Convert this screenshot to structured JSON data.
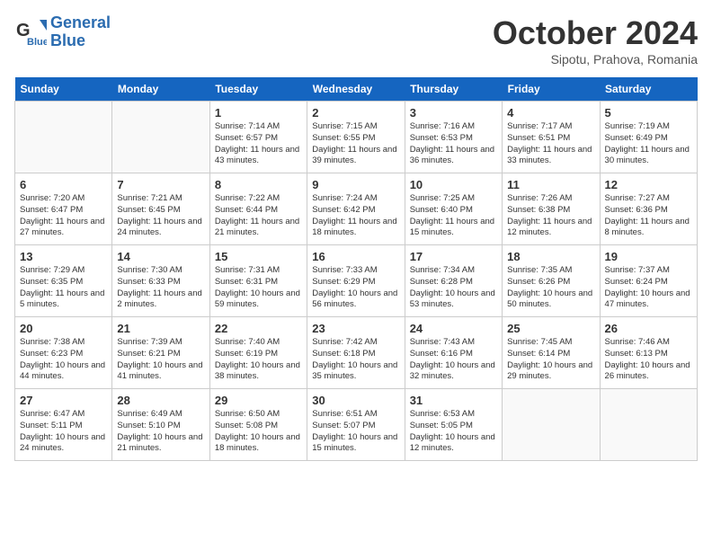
{
  "header": {
    "logo_line1": "General",
    "logo_line2": "Blue",
    "month": "October 2024",
    "location": "Sipotu, Prahova, Romania"
  },
  "days_of_week": [
    "Sunday",
    "Monday",
    "Tuesday",
    "Wednesday",
    "Thursday",
    "Friday",
    "Saturday"
  ],
  "weeks": [
    [
      {
        "day": "",
        "info": ""
      },
      {
        "day": "",
        "info": ""
      },
      {
        "day": "1",
        "info": "Sunrise: 7:14 AM\nSunset: 6:57 PM\nDaylight: 11 hours and 43 minutes."
      },
      {
        "day": "2",
        "info": "Sunrise: 7:15 AM\nSunset: 6:55 PM\nDaylight: 11 hours and 39 minutes."
      },
      {
        "day": "3",
        "info": "Sunrise: 7:16 AM\nSunset: 6:53 PM\nDaylight: 11 hours and 36 minutes."
      },
      {
        "day": "4",
        "info": "Sunrise: 7:17 AM\nSunset: 6:51 PM\nDaylight: 11 hours and 33 minutes."
      },
      {
        "day": "5",
        "info": "Sunrise: 7:19 AM\nSunset: 6:49 PM\nDaylight: 11 hours and 30 minutes."
      }
    ],
    [
      {
        "day": "6",
        "info": "Sunrise: 7:20 AM\nSunset: 6:47 PM\nDaylight: 11 hours and 27 minutes."
      },
      {
        "day": "7",
        "info": "Sunrise: 7:21 AM\nSunset: 6:45 PM\nDaylight: 11 hours and 24 minutes."
      },
      {
        "day": "8",
        "info": "Sunrise: 7:22 AM\nSunset: 6:44 PM\nDaylight: 11 hours and 21 minutes."
      },
      {
        "day": "9",
        "info": "Sunrise: 7:24 AM\nSunset: 6:42 PM\nDaylight: 11 hours and 18 minutes."
      },
      {
        "day": "10",
        "info": "Sunrise: 7:25 AM\nSunset: 6:40 PM\nDaylight: 11 hours and 15 minutes."
      },
      {
        "day": "11",
        "info": "Sunrise: 7:26 AM\nSunset: 6:38 PM\nDaylight: 11 hours and 12 minutes."
      },
      {
        "day": "12",
        "info": "Sunrise: 7:27 AM\nSunset: 6:36 PM\nDaylight: 11 hours and 8 minutes."
      }
    ],
    [
      {
        "day": "13",
        "info": "Sunrise: 7:29 AM\nSunset: 6:35 PM\nDaylight: 11 hours and 5 minutes."
      },
      {
        "day": "14",
        "info": "Sunrise: 7:30 AM\nSunset: 6:33 PM\nDaylight: 11 hours and 2 minutes."
      },
      {
        "day": "15",
        "info": "Sunrise: 7:31 AM\nSunset: 6:31 PM\nDaylight: 10 hours and 59 minutes."
      },
      {
        "day": "16",
        "info": "Sunrise: 7:33 AM\nSunset: 6:29 PM\nDaylight: 10 hours and 56 minutes."
      },
      {
        "day": "17",
        "info": "Sunrise: 7:34 AM\nSunset: 6:28 PM\nDaylight: 10 hours and 53 minutes."
      },
      {
        "day": "18",
        "info": "Sunrise: 7:35 AM\nSunset: 6:26 PM\nDaylight: 10 hours and 50 minutes."
      },
      {
        "day": "19",
        "info": "Sunrise: 7:37 AM\nSunset: 6:24 PM\nDaylight: 10 hours and 47 minutes."
      }
    ],
    [
      {
        "day": "20",
        "info": "Sunrise: 7:38 AM\nSunset: 6:23 PM\nDaylight: 10 hours and 44 minutes."
      },
      {
        "day": "21",
        "info": "Sunrise: 7:39 AM\nSunset: 6:21 PM\nDaylight: 10 hours and 41 minutes."
      },
      {
        "day": "22",
        "info": "Sunrise: 7:40 AM\nSunset: 6:19 PM\nDaylight: 10 hours and 38 minutes."
      },
      {
        "day": "23",
        "info": "Sunrise: 7:42 AM\nSunset: 6:18 PM\nDaylight: 10 hours and 35 minutes."
      },
      {
        "day": "24",
        "info": "Sunrise: 7:43 AM\nSunset: 6:16 PM\nDaylight: 10 hours and 32 minutes."
      },
      {
        "day": "25",
        "info": "Sunrise: 7:45 AM\nSunset: 6:14 PM\nDaylight: 10 hours and 29 minutes."
      },
      {
        "day": "26",
        "info": "Sunrise: 7:46 AM\nSunset: 6:13 PM\nDaylight: 10 hours and 26 minutes."
      }
    ],
    [
      {
        "day": "27",
        "info": "Sunrise: 6:47 AM\nSunset: 5:11 PM\nDaylight: 10 hours and 24 minutes."
      },
      {
        "day": "28",
        "info": "Sunrise: 6:49 AM\nSunset: 5:10 PM\nDaylight: 10 hours and 21 minutes."
      },
      {
        "day": "29",
        "info": "Sunrise: 6:50 AM\nSunset: 5:08 PM\nDaylight: 10 hours and 18 minutes."
      },
      {
        "day": "30",
        "info": "Sunrise: 6:51 AM\nSunset: 5:07 PM\nDaylight: 10 hours and 15 minutes."
      },
      {
        "day": "31",
        "info": "Sunrise: 6:53 AM\nSunset: 5:05 PM\nDaylight: 10 hours and 12 minutes."
      },
      {
        "day": "",
        "info": ""
      },
      {
        "day": "",
        "info": ""
      }
    ]
  ]
}
